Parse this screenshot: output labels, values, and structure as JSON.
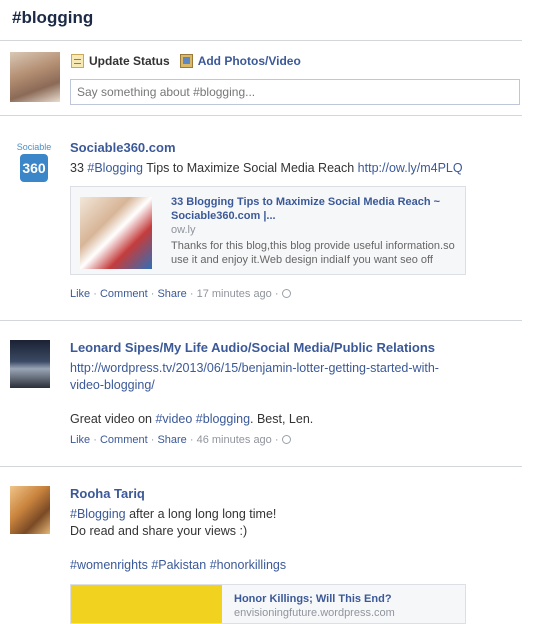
{
  "page": {
    "title": "#blogging"
  },
  "composer": {
    "update_status_label": "Update Status",
    "add_photos_label": "Add Photos/Video",
    "placeholder": "Say something about #blogging..."
  },
  "posts": [
    {
      "author": "Sociable360.com",
      "avatar": {
        "brand": "Sociable",
        "badge": "360"
      },
      "text_prefix": "33 ",
      "hashtag": "#Blogging",
      "text_middle": " Tips to Maximize Social Media Reach ",
      "link": "http://ow.ly/m4PLQ",
      "share": {
        "title": "33 Blogging Tips to Maximize Social Media Reach ~ Sociable360.com |...",
        "domain": "ow.ly",
        "description": "Thanks for this blog,this blog provide useful information.so use it and enjoy it.Web design indiaIf you want seo off"
      },
      "meta": {
        "like": "Like",
        "comment": "Comment",
        "share": "Share",
        "time": "17 minutes ago"
      }
    },
    {
      "author": "Leonard Sipes/My Life Audio/Social Media/Public Relations",
      "link_line1": "http://wordpress.tv/2013/06/15/benjamin-lotter-getting-started-with-",
      "link_line2": "video-blogging/",
      "text_prefix": "Great video on ",
      "hashtag1": "#video",
      "hashtag2": "#blogging",
      "text_suffix": ". Best, Len.",
      "meta": {
        "like": "Like",
        "comment": "Comment",
        "share": "Share",
        "time": "46 minutes ago"
      }
    },
    {
      "author": "Rooha Tariq",
      "hashtag": "#Blogging",
      "text_line1_suffix": " after a long long long time!",
      "text_line2": "Do read and share your views :)",
      "tags": [
        "#womenrights",
        "#Pakistan",
        "#honorkillings"
      ],
      "share": {
        "title": "Honor Killings; Will This End?",
        "domain": "envisioningfuture.wordpress.com"
      }
    }
  ]
}
